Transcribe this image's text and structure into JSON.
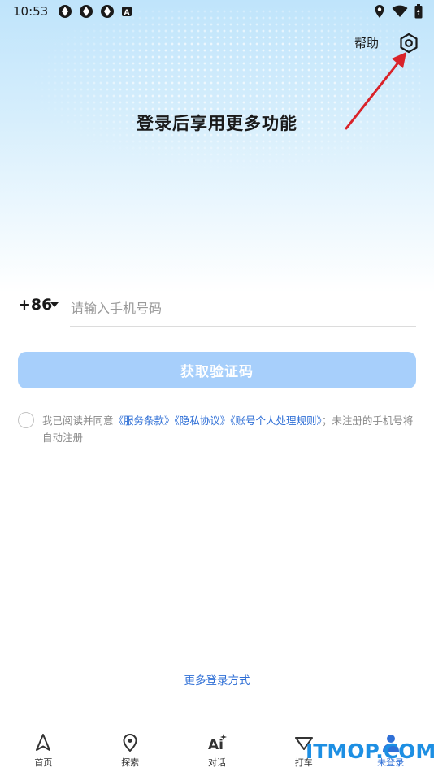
{
  "status_bar": {
    "time": "10:53",
    "left_icons": [
      "aperture-icon",
      "aperture-icon",
      "aperture-icon",
      "a-badge-icon"
    ],
    "right_icons": [
      "location-icon",
      "wifi-icon",
      "battery-icon"
    ]
  },
  "header": {
    "help_label": "帮助",
    "settings_icon": "settings-icon"
  },
  "hero": {
    "title": "登录后享用更多功能"
  },
  "login_form": {
    "country_code": "+86",
    "phone_placeholder": "请输入手机号码",
    "get_code_label": "获取验证码"
  },
  "agreement": {
    "prefix": "我已阅读并同意",
    "terms_link": "《服务条款》",
    "privacy_link": "《隐私协议》",
    "personal_info_link": "《账号个人处理规则》",
    "suffix": "；未注册的手机号将自动注册"
  },
  "more_login": "更多登录方式",
  "bottom_nav": {
    "items": [
      {
        "label": "首页",
        "icon": "navigation-arrow-icon"
      },
      {
        "label": "探索",
        "icon": "location-pin-icon"
      },
      {
        "label": "对话",
        "icon": "ai-icon"
      },
      {
        "label": "打车",
        "icon": "taxi-icon"
      },
      {
        "label": "未登录",
        "icon": "user-icon"
      }
    ]
  },
  "watermark": "ITMOP.COM",
  "colors": {
    "accent": "#2f6fd6",
    "button_disabled": "#a7cffb",
    "annotation_arrow": "#d9232a"
  }
}
